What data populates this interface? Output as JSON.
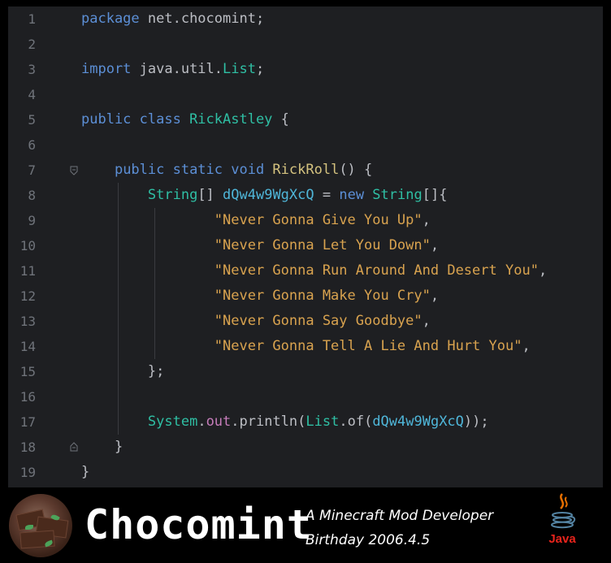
{
  "editor": {
    "lines": [
      {
        "num": "1",
        "tokens": [
          [
            "kwb",
            "package"
          ],
          [
            "pkg",
            " net.chocomint"
          ],
          [
            "pun",
            ";"
          ]
        ]
      },
      {
        "num": "2",
        "tokens": []
      },
      {
        "num": "3",
        "tokens": [
          [
            "kwb",
            "import"
          ],
          [
            "pkg",
            " java.util."
          ],
          [
            "cls",
            "List"
          ],
          [
            "pun",
            ";"
          ]
        ]
      },
      {
        "num": "4",
        "tokens": []
      },
      {
        "num": "5",
        "tokens": [
          [
            "kwb",
            "public class "
          ],
          [
            "cls",
            "RickAstley"
          ],
          [
            "pun",
            " {"
          ]
        ]
      },
      {
        "num": "6",
        "tokens": []
      },
      {
        "num": "7",
        "tokens": [
          [
            "pun",
            "    "
          ],
          [
            "kwb",
            "public static void "
          ],
          [
            "fn",
            "RickRoll"
          ],
          [
            "pun",
            "() {"
          ]
        ]
      },
      {
        "num": "8",
        "tokens": [
          [
            "pun",
            "        "
          ],
          [
            "cls",
            "String"
          ],
          [
            "pun",
            "[] "
          ],
          [
            "var",
            "dQw4w9WgXcQ"
          ],
          [
            "pun",
            " = "
          ],
          [
            "kwb",
            "new "
          ],
          [
            "cls",
            "String"
          ],
          [
            "pun",
            "[]{"
          ]
        ]
      },
      {
        "num": "9",
        "tokens": [
          [
            "pun",
            "                "
          ],
          [
            "sty",
            "\"Never Gonna Give You Up\""
          ],
          [
            "pun",
            ","
          ]
        ]
      },
      {
        "num": "10",
        "tokens": [
          [
            "pun",
            "                "
          ],
          [
            "sty",
            "\"Never Gonna Let You Down\""
          ],
          [
            "pun",
            ","
          ]
        ]
      },
      {
        "num": "11",
        "tokens": [
          [
            "pun",
            "                "
          ],
          [
            "sty",
            "\"Never Gonna Run Around And Desert You\""
          ],
          [
            "pun",
            ","
          ]
        ]
      },
      {
        "num": "12",
        "tokens": [
          [
            "pun",
            "                "
          ],
          [
            "sty",
            "\"Never Gonna Make You Cry\""
          ],
          [
            "pun",
            ","
          ]
        ]
      },
      {
        "num": "13",
        "tokens": [
          [
            "pun",
            "                "
          ],
          [
            "sty",
            "\"Never Gonna Say Goodbye\""
          ],
          [
            "pun",
            ","
          ]
        ]
      },
      {
        "num": "14",
        "tokens": [
          [
            "pun",
            "                "
          ],
          [
            "sty",
            "\"Never Gonna Tell A Lie And Hurt You\""
          ],
          [
            "pun",
            ","
          ]
        ]
      },
      {
        "num": "15",
        "tokens": [
          [
            "pun",
            "        };"
          ]
        ]
      },
      {
        "num": "16",
        "tokens": []
      },
      {
        "num": "17",
        "tokens": [
          [
            "pun",
            "        "
          ],
          [
            "cls",
            "System"
          ],
          [
            "pun",
            "."
          ],
          [
            "fld",
            "out"
          ],
          [
            "pun",
            ".println("
          ],
          [
            "cls",
            "List"
          ],
          [
            "pun",
            ".of("
          ],
          [
            "var",
            "dQw4w9WgXcQ"
          ],
          [
            "pun",
            "));"
          ]
        ]
      },
      {
        "num": "18",
        "tokens": [
          [
            "pun",
            "    }"
          ]
        ]
      },
      {
        "num": "19",
        "tokens": [
          [
            "pun",
            "}"
          ]
        ]
      }
    ]
  },
  "footer": {
    "brand": "Chocomint",
    "tagline_line1": "A Minecraft Mod Developer",
    "tagline_line2": "Birthday 2006.4.5",
    "logo_text": "Java",
    "avatar_icon": "chocolate-mint-avatar",
    "java_icon": "java-coffee-cup-icon"
  },
  "colors": {
    "editor_bg": "#1e1f22",
    "keyword": "#5c8fd6",
    "class": "#2fbfa4",
    "method": "#d4c27f",
    "string": "#d9a34f",
    "variable": "#4fb6d9",
    "field": "#c77dbb",
    "line_number": "#6f737a"
  }
}
